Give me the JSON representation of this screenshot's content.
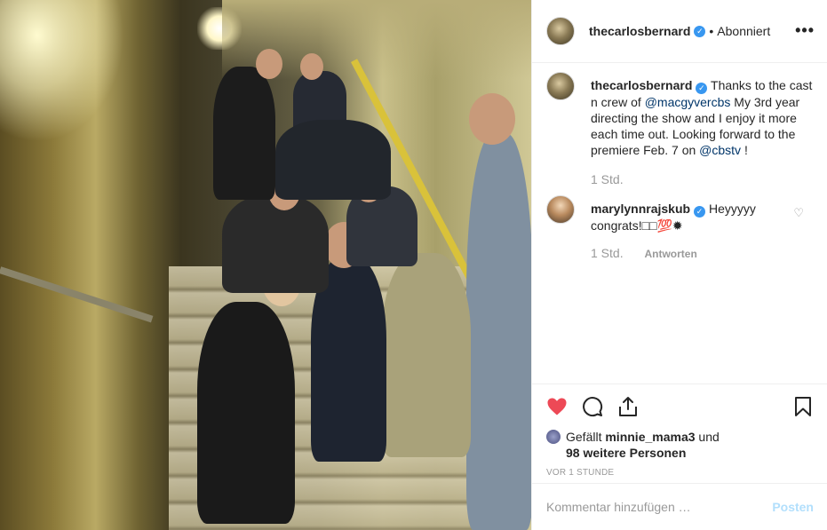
{
  "header": {
    "username": "thecarlosbernard",
    "separator": "•",
    "follow_status": "Abonniert",
    "more": "•••"
  },
  "caption": {
    "username": "thecarlosbernard",
    "text_1": "Thanks to the cast n crew of ",
    "mention_1": "@macgyvercbs",
    "text_2": " My 3rd year directing the show and I enjoy it more each time out. Looking forward to the premiere Feb. 7 on ",
    "mention_2": "@cbstv",
    "text_3": " !",
    "time": "1 Std."
  },
  "comment": {
    "username": "marylynnrajskub",
    "text": "Heyyyyy congrats!□□💯✹",
    "time": "1 Std.",
    "reply": "Antworten"
  },
  "likes": {
    "prefix": "Gefällt ",
    "user": "minnie_mama3",
    "mid": " und ",
    "others": "98 weitere Personen"
  },
  "timestamp": "VOR 1 STUNDE",
  "add_comment": {
    "placeholder": "Kommentar hinzufügen …",
    "post_label": "Posten"
  },
  "colors": {
    "like_red": "#ed4956",
    "verified_blue": "#3897f0",
    "post_disabled": "#b2dffc"
  },
  "icons": [
    "heart-filled-icon",
    "comment-icon",
    "share-icon",
    "bookmark-icon",
    "verified-icon",
    "heart-outline-icon",
    "more-icon"
  ]
}
